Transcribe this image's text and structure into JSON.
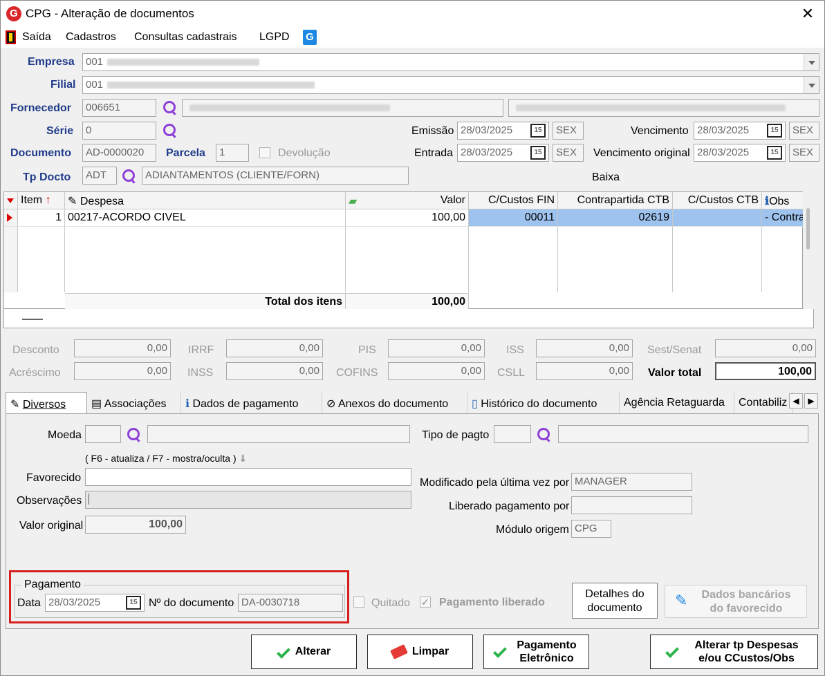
{
  "window": {
    "title": "CPG - Alteração de documentos",
    "logo_letter": "G",
    "close_glyph": "✕"
  },
  "menu": [
    "Saída",
    "Cadastros",
    "Consultas cadastrais",
    "LGPD"
  ],
  "header": {
    "empresa_label": "Empresa",
    "empresa_code": "001",
    "filial_label": "Filial",
    "filial_code": "001",
    "fornecedor_label": "Fornecedor",
    "fornecedor_code": "006651",
    "serie_label": "Série",
    "serie_value": "0",
    "documento_label": "Documento",
    "documento_value": "AD-0000020",
    "parcela_label": "Parcela",
    "parcela_value": "1",
    "devolucao_label": "Devolução",
    "tpdocto_label": "Tp Docto",
    "tpdocto_code": "ADT",
    "tpdocto_desc": "ADIANTAMENTOS (CLIENTE/FORN)",
    "emissao_label": "Emissão",
    "emissao_date": "28/03/2025",
    "emissao_day": "SEX",
    "entrada_label": "Entrada",
    "entrada_date": "28/03/2025",
    "entrada_day": "SEX",
    "vencimento_label": "Vencimento",
    "vencimento_date": "28/03/2025",
    "vencimento_day": "SEX",
    "venc_original_label": "Vencimento original",
    "venc_original_date": "28/03/2025",
    "venc_original_day": "SEX",
    "baixa_label": "Baixa",
    "calendar_glyph": "15"
  },
  "grid": {
    "columns": [
      "Item",
      "Despesa",
      "Valor",
      "C/Custos FIN",
      "Contrapartida CTB",
      "C/Custos CTB",
      "Obs"
    ],
    "rows": [
      {
        "item": "1",
        "despesa": "00217-ACORDO CIVEL",
        "valor": "100,00",
        "ccfin": "00011",
        "contrapartida": "02619",
        "ccctb": "",
        "obs": "- Contra"
      }
    ],
    "total_label": "Total dos itens",
    "total_value": "100,00"
  },
  "taxes": {
    "desconto": {
      "label": "Desconto",
      "value": "0,00"
    },
    "acrescimo": {
      "label": "Acréscimo",
      "value": "0,00"
    },
    "irrf": {
      "label": "IRRF",
      "value": "0,00"
    },
    "inss": {
      "label": "INSS",
      "value": "0,00"
    },
    "pis": {
      "label": "PIS",
      "value": "0,00"
    },
    "cofins": {
      "label": "COFINS",
      "value": "0,00"
    },
    "iss": {
      "label": "ISS",
      "value": "0,00"
    },
    "csll": {
      "label": "CSLL",
      "value": "0,00"
    },
    "sest": {
      "label": "Sest/Senat",
      "value": "0,00"
    },
    "valor_total": {
      "label": "Valor total",
      "value": "100,00"
    }
  },
  "tabs": [
    "Diversos",
    "Associações",
    "Dados de pagamento",
    "Anexos do documento",
    "Histórico do documento",
    "Agência Retaguarda",
    "Contabiliz"
  ],
  "diversos": {
    "moeda_label": "Moeda",
    "tipo_pagto_label": "Tipo de pagto",
    "hint": "( F6 - atualiza / F7 - mostra/oculta )",
    "favorecido_label": "Favorecido",
    "observacoes_label": "Observações",
    "valor_original_label": "Valor original",
    "valor_original": "100,00",
    "modificado_label": "Modificado pela última vez por",
    "modificado_value": "MANAGER",
    "liberado_label": "Liberado pagamento por",
    "modulo_label": "Módulo origem",
    "modulo_value": "CPG"
  },
  "pagamento": {
    "group_label": "Pagamento",
    "data_label": "Data",
    "data_value": "28/03/2025",
    "numdoc_label": "Nº do documento",
    "numdoc_value": "DA-0030718",
    "quitado_label": "Quitado",
    "liberado_label": "Pagamento liberado"
  },
  "side_buttons": {
    "detalhes_line1": "Detalhes do",
    "detalhes_line2": "documento",
    "bancarios_line1": "Dados bancários",
    "bancarios_line2": "do favorecido"
  },
  "footer_buttons": {
    "alterar": "Alterar",
    "limpar": "Limpar",
    "pag_line1": "Pagamento",
    "pag_line2": "Eletrônico",
    "alt_line1": "Alterar tp Despesas",
    "alt_line2": "e/ou CCustos/Obs"
  },
  "colors": {
    "label_blue": "#1f3b8a",
    "selection_blue": "#9fc3ef",
    "check_green": "#2db34a",
    "highlight_red": "#d62020"
  }
}
